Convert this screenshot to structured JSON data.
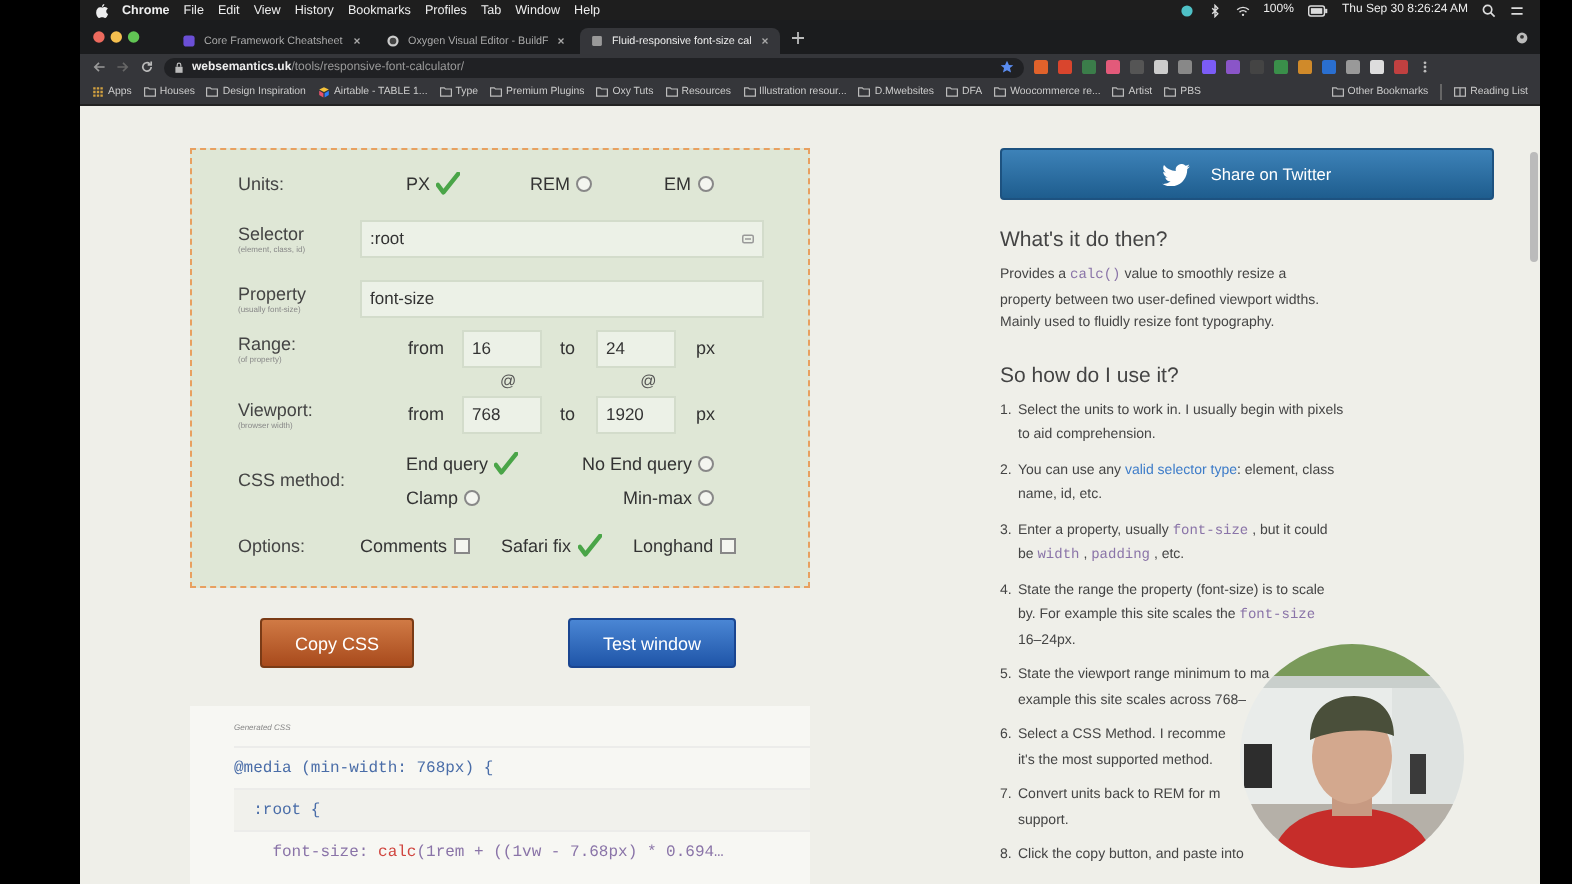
{
  "menubar": {
    "app": "Chrome",
    "menus": [
      "File",
      "Edit",
      "View",
      "History",
      "Bookmarks",
      "Profiles",
      "Tab",
      "Window",
      "Help"
    ],
    "battery": "100%",
    "clock": "Thu Sep 30  8:26:24 AM"
  },
  "tabs": [
    {
      "title": "Core Framework Cheatsheet",
      "selected": false
    },
    {
      "title": "Oxygen Visual Editor - BuildF",
      "selected": false
    },
    {
      "title": "Fluid-responsive font-size cal",
      "selected": true
    }
  ],
  "address": {
    "domain": "websemantics.uk",
    "path": "/tools/responsive-font-calculator/"
  },
  "bookmarks": [
    {
      "label": "Apps",
      "kind": "apps"
    },
    {
      "label": "Houses",
      "kind": "folder"
    },
    {
      "label": "Design Inspiration",
      "kind": "folder"
    },
    {
      "label": "Airtable - TABLE 1...",
      "kind": "site"
    },
    {
      "label": "Type",
      "kind": "folder"
    },
    {
      "label": "Premium Plugins",
      "kind": "folder"
    },
    {
      "label": "Oxy Tuts",
      "kind": "folder"
    },
    {
      "label": "Resources",
      "kind": "folder"
    },
    {
      "label": "Illustration resour...",
      "kind": "folder"
    },
    {
      "label": "D.Mwebsites",
      "kind": "folder"
    },
    {
      "label": "DFA",
      "kind": "folder"
    },
    {
      "label": "Woocommerce re...",
      "kind": "folder"
    },
    {
      "label": "Artist",
      "kind": "folder"
    },
    {
      "label": "PBS",
      "kind": "folder"
    }
  ],
  "other_bookmarks": "Other Bookmarks",
  "reading_list": "Reading List",
  "calculator": {
    "rows": [
      {
        "kind": "units",
        "label": "Units:",
        "options": [
          {
            "label": "PX",
            "selected": true
          },
          {
            "label": "REM",
            "selected": false
          },
          {
            "label": "EM",
            "selected": false
          }
        ]
      },
      {
        "kind": "text",
        "label": "Selector",
        "hint": "(element, class, id)",
        "value": ":root"
      },
      {
        "kind": "text",
        "label": "Property",
        "hint": "(usually font-size)",
        "value": "font-size"
      },
      {
        "kind": "range",
        "label": "Range:",
        "hint": "(of property)",
        "from_word": "from",
        "from": "16",
        "to_word": "to",
        "to": "24",
        "unit": "px"
      },
      {
        "kind": "at",
        "marks": [
          "@",
          "@"
        ]
      },
      {
        "kind": "range",
        "label": "Viewport:",
        "hint": "(browser width)",
        "from_word": "from",
        "from": "768",
        "to_word": "to",
        "to": "1920",
        "unit": "px"
      },
      {
        "kind": "method",
        "label": "CSS method:",
        "options": [
          {
            "label": "End query",
            "selected": true
          },
          {
            "label": "No End query",
            "selected": false
          },
          {
            "label": "Clamp",
            "selected": false
          },
          {
            "label": "Min-max",
            "selected": false
          }
        ]
      },
      {
        "kind": "options",
        "label": "Options:",
        "options": [
          {
            "label": "Comments",
            "checked": false
          },
          {
            "label": "Safari fix",
            "checked": true
          },
          {
            "label": "Longhand",
            "checked": false
          }
        ]
      }
    ]
  },
  "buttons": {
    "copy": "Copy CSS",
    "test": "Test window"
  },
  "generated": {
    "title": "Generated CSS",
    "lines": [
      [
        {
          "text": "@media (min-width: 768px) {",
          "kind": "keyword"
        }
      ],
      [
        {
          "text": "  :root {",
          "kind": "keyword"
        }
      ],
      [
        {
          "text": "    font-size: ",
          "kind": "property"
        },
        {
          "text": "calc",
          "kind": "function"
        },
        {
          "text": "(1rem + ((1vw - 7.68px) * 0.694…",
          "kind": "property"
        }
      ]
    ]
  },
  "sidebar": {
    "share": "Share on Twitter",
    "sections": [
      {
        "heading": "What's it do then?",
        "paragraph": [
          [
            {
              "text": "Provides a ",
              "kind": "plain"
            },
            {
              "text": "calc()",
              "kind": "code"
            },
            {
              "text": " value to smoothly resize a",
              "kind": "plain"
            }
          ],
          [
            {
              "text": "property between two user-defined viewport widths.",
              "kind": "plain"
            }
          ],
          [
            {
              "text": "Mainly used to fluidly resize font typography.",
              "kind": "plain"
            }
          ]
        ]
      },
      {
        "heading": "So how do I use it?",
        "steps": [
          {
            "number": "1.",
            "lines": [
              [
                {
                  "text": "Select the units to work in. I usually begin with pixels",
                  "kind": "plain"
                }
              ],
              [
                {
                  "text": "to aid comprehension.",
                  "kind": "plain"
                }
              ]
            ]
          },
          {
            "number": "2.",
            "lines": [
              [
                {
                  "text": "You can use any ",
                  "kind": "plain"
                },
                {
                  "text": "valid selector type",
                  "kind": "link"
                },
                {
                  "text": ": element, class",
                  "kind": "plain"
                }
              ],
              [
                {
                  "text": "name, id, etc.",
                  "kind": "plain"
                }
              ]
            ]
          },
          {
            "number": "3.",
            "lines": [
              [
                {
                  "text": "Enter a property, usually ",
                  "kind": "plain"
                },
                {
                  "text": "font-size",
                  "kind": "code"
                },
                {
                  "text": " , but it could",
                  "kind": "plain"
                }
              ],
              [
                {
                  "text": "be ",
                  "kind": "plain"
                },
                {
                  "text": "width",
                  "kind": "code"
                },
                {
                  "text": " , ",
                  "kind": "plain"
                },
                {
                  "text": "padding",
                  "kind": "code"
                },
                {
                  "text": " , etc.",
                  "kind": "plain"
                }
              ]
            ]
          },
          {
            "number": "4.",
            "lines": [
              [
                {
                  "text": "State the range the property (font-size) is to scale",
                  "kind": "plain"
                }
              ],
              [
                {
                  "text": "by. For example this site scales the ",
                  "kind": "plain"
                },
                {
                  "text": "font-size",
                  "kind": "code"
                }
              ],
              [
                {
                  "text": "16–24px.",
                  "kind": "plain"
                }
              ]
            ]
          },
          {
            "number": "5.",
            "lines": [
              [
                {
                  "text": "State the viewport range minimum to ma",
                  "kind": "plain"
                }
              ],
              [
                {
                  "text": "example this site scales across 768–",
                  "kind": "plain"
                }
              ]
            ]
          },
          {
            "number": "6.",
            "lines": [
              [
                {
                  "text": "Select a CSS Method. I recomme",
                  "kind": "plain"
                }
              ],
              [
                {
                  "text": "it's the most supported method.",
                  "kind": "plain"
                }
              ]
            ]
          },
          {
            "number": "7.",
            "lines": [
              [
                {
                  "text": "Convert units back to REM for m",
                  "kind": "plain"
                }
              ],
              [
                {
                  "text": "support.",
                  "kind": "plain"
                }
              ]
            ]
          },
          {
            "number": "8.",
            "lines": [
              [
                {
                  "text": "Click the copy button, and paste into",
                  "kind": "plain"
                }
              ]
            ]
          }
        ]
      }
    ]
  }
}
